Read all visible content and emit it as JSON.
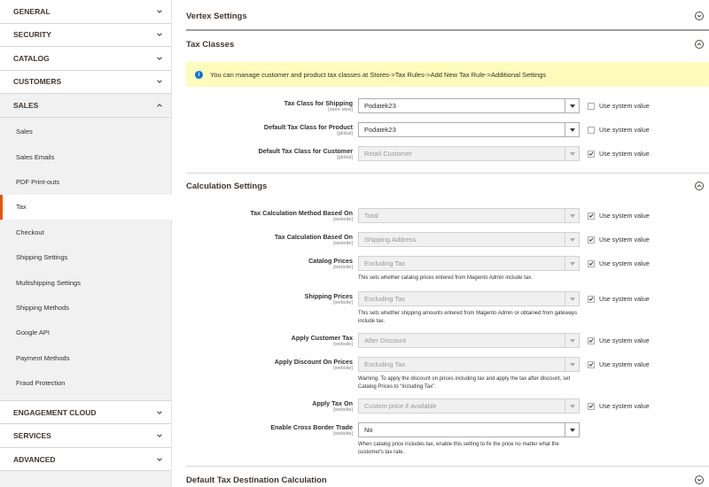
{
  "sidebar": {
    "top_sections": [
      {
        "label": "GENERAL",
        "expanded": false
      },
      {
        "label": "SECURITY",
        "expanded": false
      },
      {
        "label": "CATALOG",
        "expanded": false
      },
      {
        "label": "CUSTOMERS",
        "expanded": false
      },
      {
        "label": "SALES",
        "expanded": true
      }
    ],
    "sales_items": [
      "Sales",
      "Sales Emails",
      "PDF Print-outs",
      "Tax",
      "Checkout",
      "Shipping Settings",
      "Multishipping Settings",
      "Shipping Methods",
      "Google API",
      "Payment Methods",
      "Fraud Protection"
    ],
    "active_item": "Tax",
    "bottom_sections": [
      {
        "label": "ENGAGEMENT CLOUD",
        "expanded": false
      },
      {
        "label": "SERVICES",
        "expanded": false
      },
      {
        "label": "ADVANCED",
        "expanded": false
      }
    ]
  },
  "groups": {
    "vertex": {
      "title": "Vertex Settings",
      "expanded": false
    },
    "tax_classes": {
      "title": "Tax Classes",
      "expanded": true
    },
    "calculation": {
      "title": "Calculation Settings",
      "expanded": true
    },
    "destination": {
      "title": "Default Tax Destination Calculation",
      "expanded": false
    }
  },
  "notice": {
    "text": "You can manage customer and product tax classes at Stores->Tax Rules->Add New Tax Rule->Additional Settings"
  },
  "tax_class_fields": [
    {
      "label": "Tax Class for Shipping",
      "scope": "[store view]",
      "value": "Podatek23",
      "disabled": false,
      "use_system": false,
      "checkbox_label": "Use system value"
    },
    {
      "label": "Default Tax Class for Product",
      "scope": "[global]",
      "value": "Podatek23",
      "disabled": false,
      "use_system": false,
      "checkbox_label": "Use system value"
    },
    {
      "label": "Default Tax Class for Customer",
      "scope": "[global]",
      "value": "Retail Customer",
      "disabled": true,
      "use_system": true,
      "checkbox_label": "Use system value"
    }
  ],
  "calc_fields": [
    {
      "label": "Tax Calculation Method Based On",
      "scope": "[website]",
      "value": "Total",
      "disabled": true,
      "use_system": true,
      "checkbox_label": "Use system value",
      "note": ""
    },
    {
      "label": "Tax Calculation Based On",
      "scope": "[website]",
      "value": "Shipping Address",
      "disabled": true,
      "use_system": true,
      "checkbox_label": "Use system value",
      "note": ""
    },
    {
      "label": "Catalog Prices",
      "scope": "[website]",
      "value": "Excluding Tax",
      "disabled": true,
      "use_system": true,
      "checkbox_label": "Use system value",
      "note": "This sets whether catalog prices entered from Magento Admin include tax."
    },
    {
      "label": "Shipping Prices",
      "scope": "[website]",
      "value": "Excluding Tax",
      "disabled": true,
      "use_system": true,
      "checkbox_label": "Use system value",
      "note": "This sets whether shipping amounts entered from Magento Admin or obtained from gateways include tax."
    },
    {
      "label": "Apply Customer Tax",
      "scope": "[website]",
      "value": "After Discount",
      "disabled": true,
      "use_system": true,
      "checkbox_label": "Use system value",
      "note": ""
    },
    {
      "label": "Apply Discount On Prices",
      "scope": "[website]",
      "value": "Excluding Tax",
      "disabled": true,
      "use_system": true,
      "checkbox_label": "Use system value",
      "note": "Warning: To apply the discount on prices including tax and apply the tax after discount, set Catalog Prices to “Including Tax”."
    },
    {
      "label": "Apply Tax On",
      "scope": "[website]",
      "value": "Custom price if available",
      "disabled": true,
      "use_system": true,
      "checkbox_label": "Use system value",
      "note": ""
    },
    {
      "label": "Enable Cross Border Trade",
      "scope": "[website]",
      "value": "No",
      "disabled": false,
      "use_system": false,
      "checkbox_label": "",
      "note": "When catalog price includes tax, enable this setting to fix the price no matter what the customer's tax rate."
    }
  ],
  "colors": {
    "accent": "#eb5202",
    "notice_bg": "#fffbbb",
    "info_icon": "#007bdb"
  }
}
